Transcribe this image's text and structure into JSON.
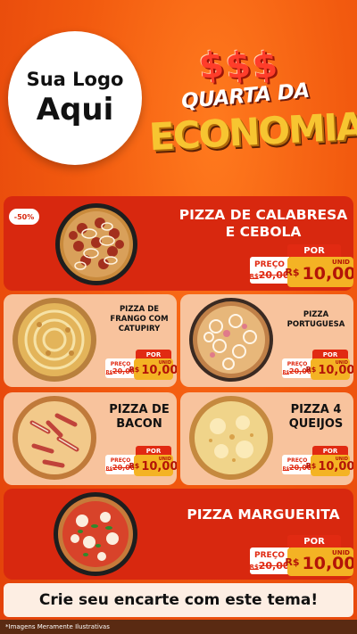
{
  "logo": {
    "line1": "Sua Logo",
    "line2": "Aqui"
  },
  "title": {
    "symbols": [
      "$",
      "$",
      "$"
    ],
    "line1": "QUARTA DA",
    "line2": "ECONOMIA"
  },
  "featured": [
    {
      "discount": "-50%",
      "name": "PIZZA DE CALABRESA E CEBOLA",
      "por": "POR",
      "preco": "PREÇO",
      "old_prefix": "R$",
      "old_price": "20,00",
      "currency": "R$",
      "price": "10,00",
      "unit": "UNID"
    },
    {
      "name": "PIZZA MARGUERITA",
      "por": "POR",
      "preco": "PREÇO",
      "old_prefix": "R$",
      "old_price": "20,00",
      "currency": "R$",
      "price": "10,00",
      "unit": "UNID"
    }
  ],
  "items": [
    {
      "name": "PIZZA DE FRANGO COM CATUPIRY",
      "por": "POR",
      "preco": "PREÇO",
      "old_prefix": "R$",
      "old_price": "20,00",
      "currency": "R$",
      "price": "10,00",
      "unit": "UNID"
    },
    {
      "name": "PIZZA PORTUGUESA",
      "por": "POR",
      "preco": "PREÇO",
      "old_prefix": "R$",
      "old_price": "20,00",
      "currency": "R$",
      "price": "10,00",
      "unit": "UNID"
    },
    {
      "name": "PIZZA DE BACON",
      "por": "POR",
      "preco": "PREÇO",
      "old_prefix": "R$",
      "old_price": "20,00",
      "currency": "R$",
      "price": "10,00",
      "unit": "UNID"
    },
    {
      "name": "PIZZA 4 QUEIJOS",
      "por": "POR",
      "preco": "PREÇO",
      "old_prefix": "R$",
      "old_price": "20,00",
      "currency": "R$",
      "price": "10,00",
      "unit": "UNID"
    }
  ],
  "cta": "Crie seu encarte com este tema!",
  "footer": "*Imagens Meramente Ilustrativas",
  "colors": {
    "background": "#f25a0f",
    "card_red": "#d8280f",
    "card_peach": "#f8c39d",
    "price_yellow": "#f4b324"
  }
}
